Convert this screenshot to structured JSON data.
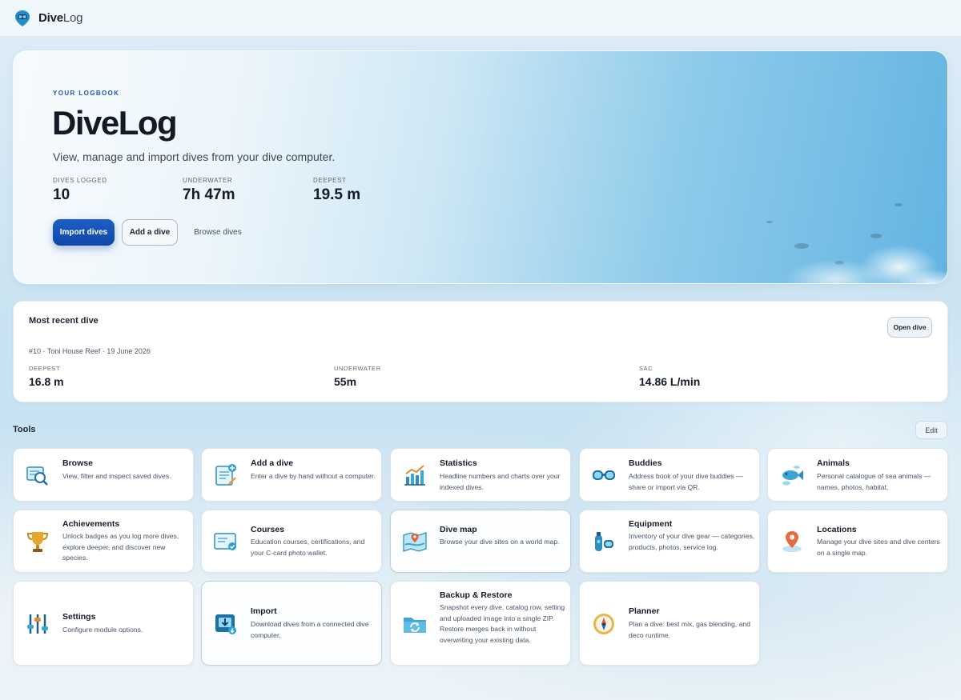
{
  "app": {
    "brand_bold": "Dive",
    "brand_light": "Log"
  },
  "hero": {
    "eyebrow": "YOUR LOGBOOK",
    "title": "DiveLog",
    "subtitle": "View, manage and import dives from your dive computer.",
    "stats": [
      {
        "label": "DIVES LOGGED",
        "value": "10"
      },
      {
        "label": "UNDERWATER",
        "value": "7h 47m"
      },
      {
        "label": "DEEPEST",
        "value": "19.5 m"
      }
    ],
    "buttons": {
      "import": "Import dives",
      "add": "Add a dive",
      "browse": "Browse dives"
    }
  },
  "recent": {
    "title": "Most recent dive",
    "open_label": "Open dive",
    "meta": "#10 · Toni House Reef · 19 June 2026",
    "stats": [
      {
        "label": "DEEPEST",
        "value": "16.8 m"
      },
      {
        "label": "UNDERWATER",
        "value": "55m"
      },
      {
        "label": "SAC",
        "value": "14.86 L/min"
      }
    ]
  },
  "tools": {
    "title": "Tools",
    "edit_label": "Edit",
    "cards": [
      {
        "title": "Browse",
        "desc": "View, filter and inspect saved dives.",
        "icon": "browse-icon"
      },
      {
        "title": "Add a dive",
        "desc": "Enter a dive by hand without a computer.",
        "icon": "add-dive-icon"
      },
      {
        "title": "Statistics",
        "desc": "Headline numbers and charts over your indexed dives.",
        "icon": "statistics-icon"
      },
      {
        "title": "Buddies",
        "desc": "Address book of your dive buddies — share or import via QR.",
        "icon": "buddies-icon"
      },
      {
        "title": "Animals",
        "desc": "Personal catalogue of sea animals — names, photos, habitat.",
        "icon": "animals-icon"
      },
      {
        "title": "Achievements",
        "desc": "Unlock badges as you log more dives, explore deeper, and discover new species.",
        "icon": "trophy-icon"
      },
      {
        "title": "Courses",
        "desc": "Education courses, certifications, and your C-card photo wallet.",
        "icon": "certificate-icon"
      },
      {
        "title": "Dive map",
        "desc": "Browse your dive sites on a world map.",
        "icon": "map-icon"
      },
      {
        "title": "Equipment",
        "desc": "Inventory of your dive gear — categories, products, photos, service log.",
        "icon": "equipment-icon"
      },
      {
        "title": "Locations",
        "desc": "Manage your dive sites and dive centers on a single map.",
        "icon": "location-pin-icon"
      },
      {
        "title": "Settings",
        "desc": "Configure module options.",
        "icon": "settings-sliders-icon"
      },
      {
        "title": "Import",
        "desc": "Download dives from a connected dive computer.",
        "icon": "import-icon"
      },
      {
        "title": "Backup & Restore",
        "desc": "Snapshot every dive, catalog row, setting and uploaded image into a single ZIP. Restore merges back in without overwriting your existing data.",
        "icon": "backup-folder-icon"
      },
      {
        "title": "Planner",
        "desc": "Plan a dive: best mix, gas blending, and deco runtime.",
        "icon": "compass-icon"
      }
    ]
  }
}
